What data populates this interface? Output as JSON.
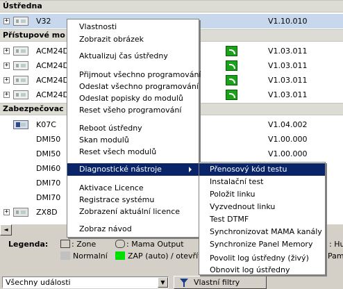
{
  "tree": {
    "sections": [
      {
        "label": "Ústředna"
      },
      {
        "label": "Přístupové mo"
      },
      {
        "label": "Zabezpečovac"
      }
    ],
    "rows": [
      {
        "name": "V32",
        "version": "V1.10.010"
      },
      {
        "name": "ACM24D",
        "version": "V1.03.011"
      },
      {
        "name": "ACM24D",
        "version": "V1.03.011"
      },
      {
        "name": "ACM24D",
        "version": "V1.03.011"
      },
      {
        "name": "ACM24D",
        "version": "V1.03.011"
      },
      {
        "name": "K07C",
        "version": "V1.04.002"
      },
      {
        "name": "DMI50",
        "version": "V1.00.000"
      },
      {
        "name": "DMI50",
        "version": "V1.00.000"
      },
      {
        "name": "DMI60",
        "version": ""
      },
      {
        "name": "DMI70",
        "version": ""
      },
      {
        "name": "DMI70",
        "version": ""
      },
      {
        "name": "ZX8D",
        "version": ""
      }
    ],
    "expander_symbol": "+"
  },
  "scrollbar": {
    "left_arrow": "◄"
  },
  "legend": {
    "label": "Legenda:",
    "zone": ": Zone",
    "mama_output": ": Mama Output",
    "normal": "Normalní",
    "zap": "ZAP (auto) / otevřít",
    "hub_partial": ": Hub",
    "pam_partial": "Pam",
    "colors": {
      "normal": "#c0c0c0",
      "zap": "#00e000"
    }
  },
  "bottom": {
    "events_select": "Všechny události",
    "filter_button": "Vlastní filtry"
  },
  "context_menu": {
    "items": [
      "Vlastnosti",
      "Zobrazit obrázek",
      "Aktualizuj čas ústředny",
      "Přijmout všechno programování",
      "Odeslat všechno programování",
      "Odeslat popisky do modulů",
      "Reset všeho programování",
      "Reboot ústředny",
      "Skan modulů",
      "Reset všech modulů",
      "Diagnostické nástroje",
      "Aktivace Licence",
      "Registrace systému",
      "Zobrazení aktuální licence",
      "Zobraz návod"
    ]
  },
  "submenu": {
    "items": [
      "Přenosový kód testu",
      "Instalační test",
      "Položit linku",
      "Vyzvednout linku",
      "Test DTMF",
      "Synchronizovat MAMA kanály",
      "Synchronize Panel Memory",
      "Povolit log ústředny (živý)",
      "Obnovit log ústředny"
    ]
  },
  "colors": {
    "highlight": "#0a246a",
    "signal": "#1aa21a",
    "selected_row": "#c8d8ec"
  }
}
